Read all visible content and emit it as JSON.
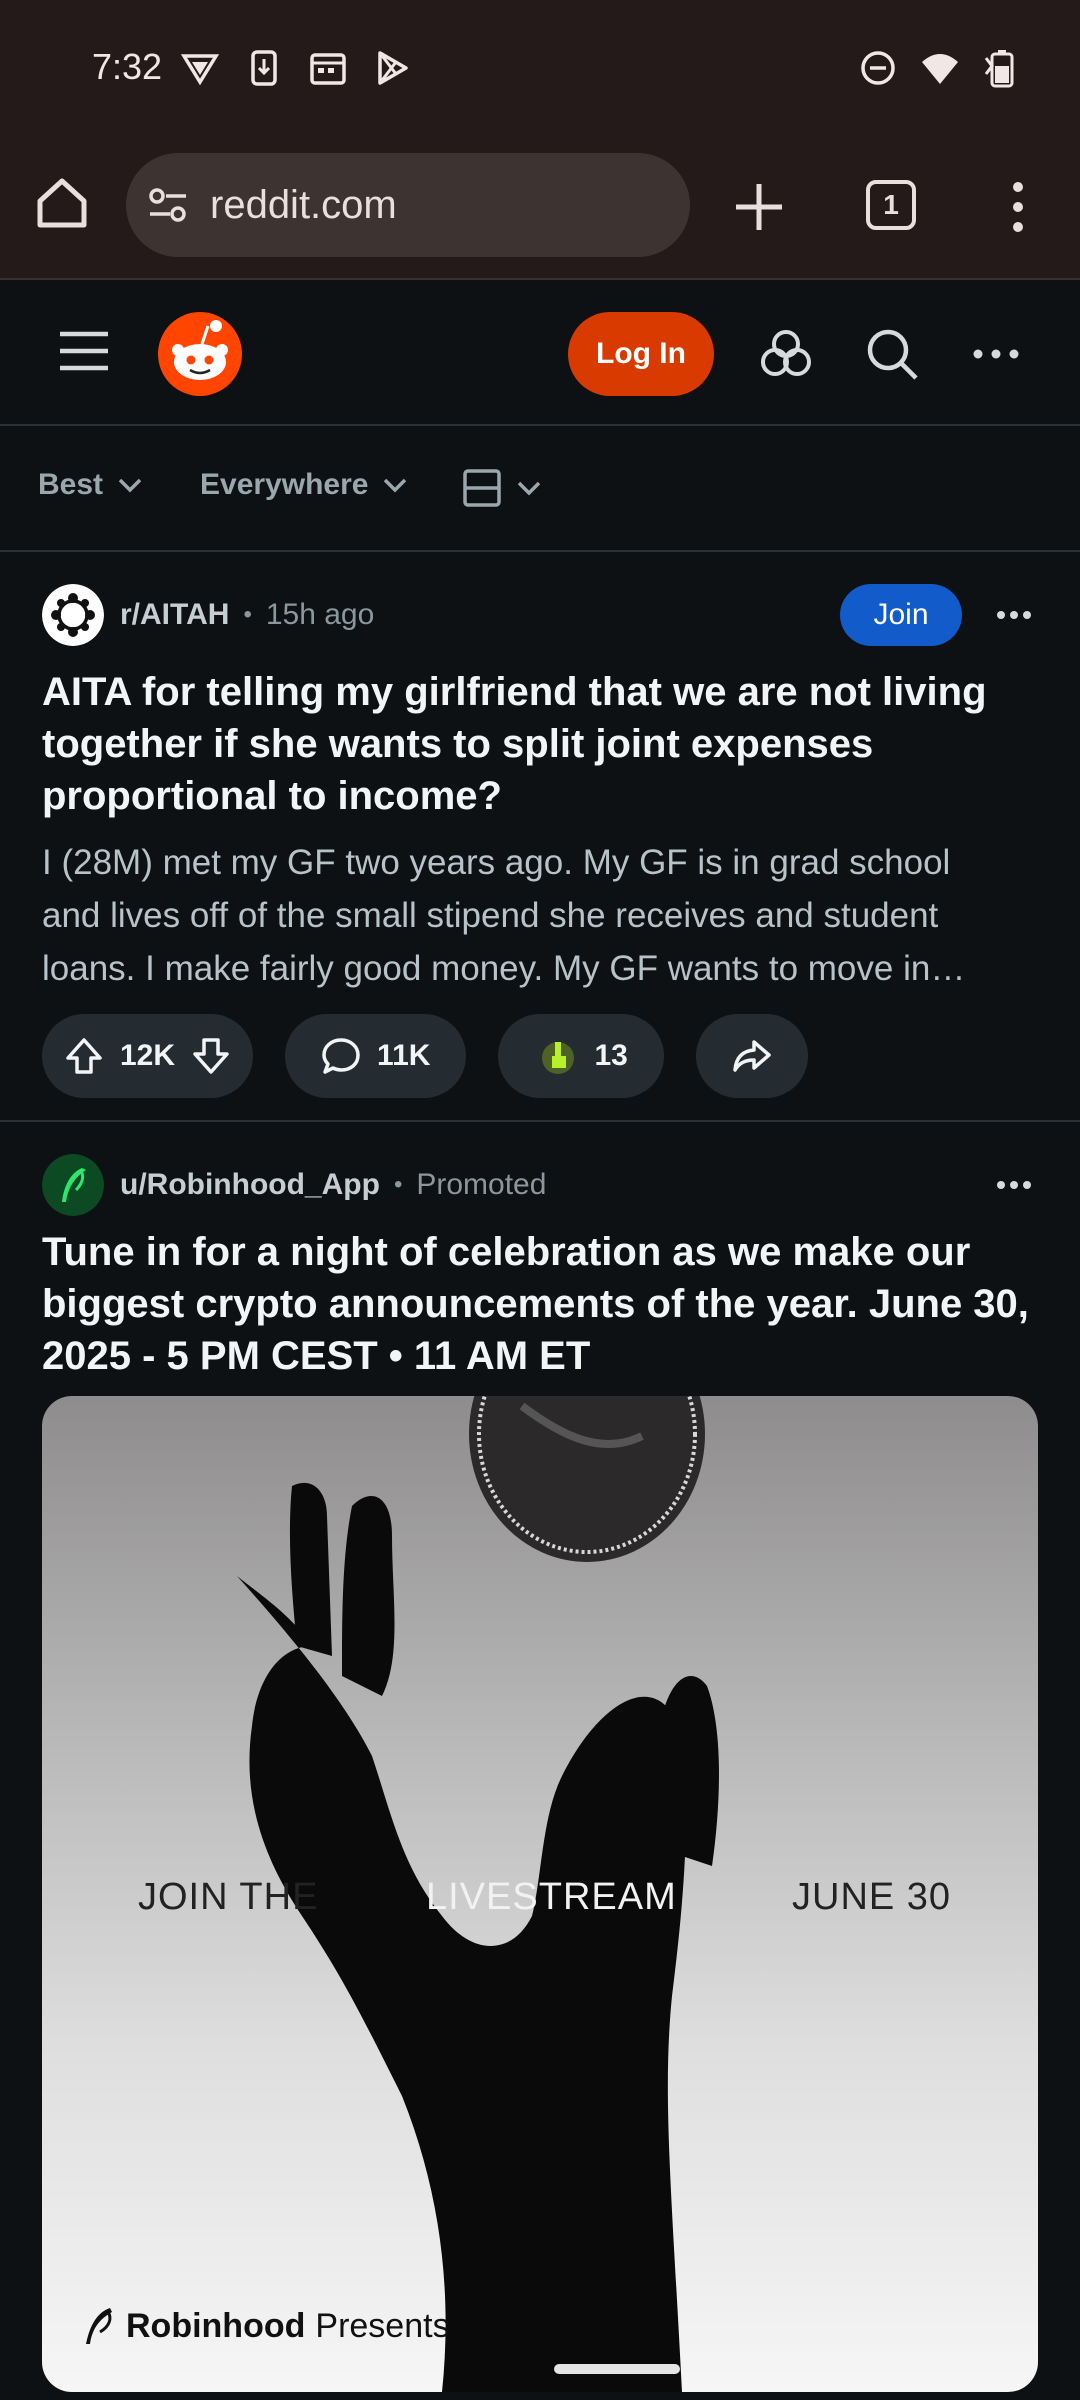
{
  "status_bar": {
    "time": "7:32",
    "left_icons": [
      "vpn-icon",
      "download-icon",
      "calendar-icon",
      "play-store-icon"
    ],
    "right_icons": [
      "dnd-icon",
      "wifi-icon",
      "battery-icon"
    ]
  },
  "browser": {
    "url": "reddit.com",
    "tab_count": "1"
  },
  "reddit_header": {
    "login_label": "Log In"
  },
  "sort_bar": {
    "sort": "Best",
    "location": "Everywhere"
  },
  "post1": {
    "subreddit": "r/AITAH",
    "separator": "•",
    "age": "15h ago",
    "join_label": "Join",
    "title": "AITA for telling my girlfriend that we are not living together if she wants to split joint expenses proportional to income?",
    "body_lines": [
      "I (28M) met my GF two years ago. My GF is in grad school",
      "and lives off of the small stipend she receives and student",
      "loans. I make fairly good money. My GF wants to move in…"
    ],
    "votes": "12K",
    "comments": "11K",
    "awards": "13"
  },
  "post2": {
    "user": "u/Robinhood_App",
    "separator": "•",
    "label": "Promoted",
    "title": "Tune in for a night of celebration as we make our biggest crypto announcements of the year. June 30, 2025 - 5 PM CEST • 11 AM ET",
    "image_text": {
      "left": "JOIN THE",
      "center": "LIVESTREAM",
      "right": "JUNE 30",
      "brand": "Robinhood",
      "brand_suffix": "Presents"
    }
  },
  "colors": {
    "accent_orange": "#d93a00",
    "join_blue": "#115bca",
    "background": "#0e1113",
    "browser_chrome": "#241a1a"
  }
}
